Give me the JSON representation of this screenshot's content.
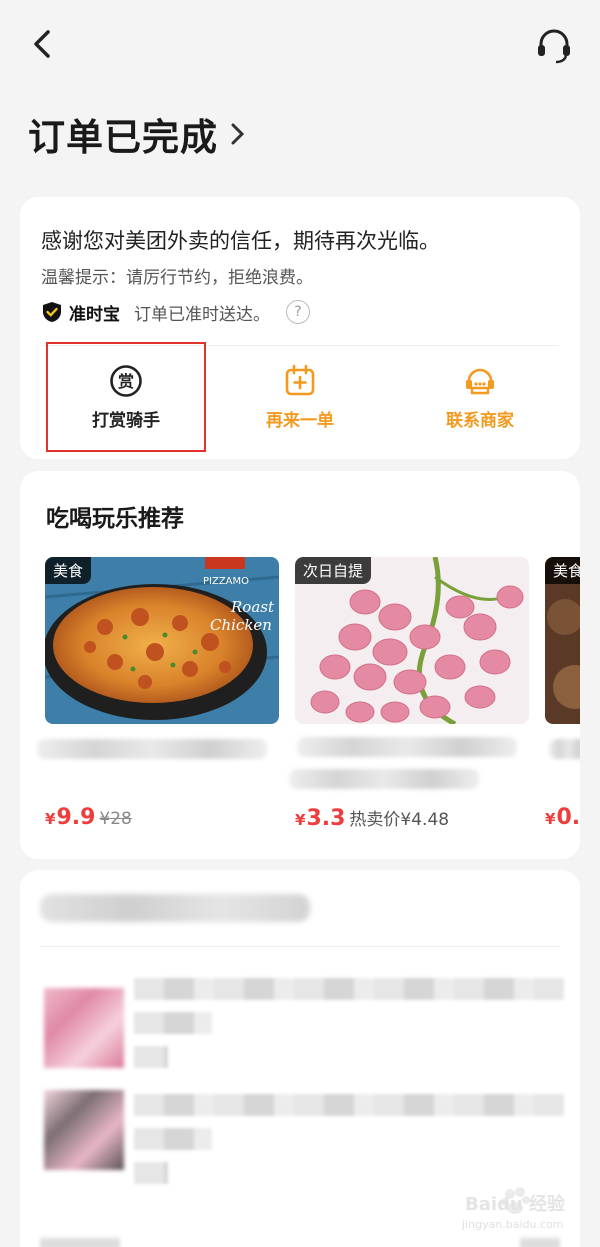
{
  "page": {
    "status_title": "订单已完成"
  },
  "order_card": {
    "thanks_message": "感谢您对美团外卖的信任，期待再次光临。",
    "tip": "温馨提示：请厉行节约，拒绝浪费。",
    "ontime_name": "准时宝",
    "ontime_desc": "订单已准时送达。",
    "help_mark": "?",
    "actions": [
      {
        "label": "打赏骑手",
        "icon": "reward-icon"
      },
      {
        "label": "再来一单",
        "icon": "reorder-icon"
      },
      {
        "label": "联系商家",
        "icon": "contact-merchant-icon"
      }
    ],
    "accent_color": "#f39a1e",
    "highlight_color": "#e0312a"
  },
  "recommendations": {
    "title": "吃喝玩乐推荐",
    "items": [
      {
        "tag": "美食",
        "price_currency": "¥",
        "price": "9.9",
        "original_price": "¥28",
        "image_text_1": "PIZZAMO",
        "image_text_2": "Roast",
        "image_text_3": "Chicken"
      },
      {
        "tag": "次日自提",
        "price_currency": "¥",
        "price": "3.3",
        "original_price": "热卖价¥4.48"
      },
      {
        "tag": "美食",
        "price_currency": "¥",
        "price": "0."
      }
    ],
    "price_color": "#ee3d3d"
  },
  "watermark": {
    "text": "Baidu 经验",
    "sub": "jingyan.baidu.com"
  }
}
